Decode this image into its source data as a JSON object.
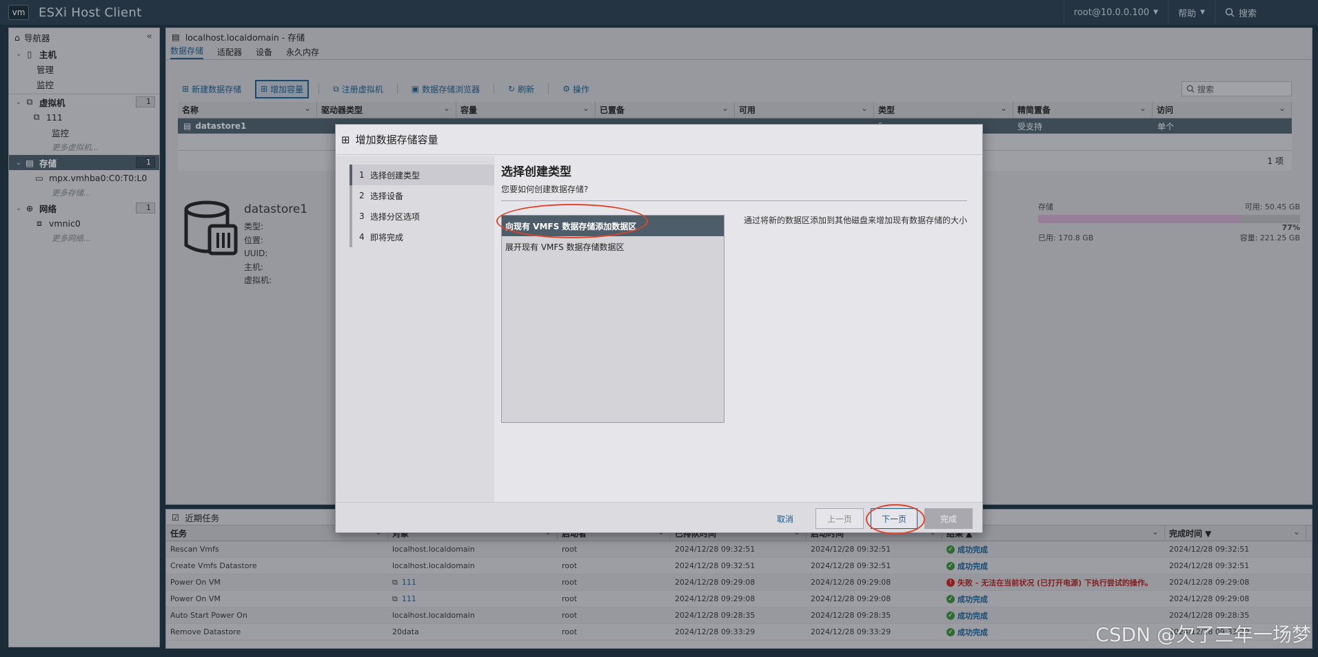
{
  "header": {
    "logo": "vm",
    "title": "ESXi Host Client",
    "user": "root@10.0.0.100",
    "help": "帮助",
    "search": "搜索"
  },
  "navigator": {
    "title": "导航器",
    "host": {
      "label": "主机",
      "children": [
        "管理",
        "监控"
      ]
    },
    "vms": {
      "label": "虚拟机",
      "count": "1",
      "vm": "111",
      "vm_child": "监控",
      "more": "更多虚拟机..."
    },
    "storage": {
      "label": "存储",
      "count": "1",
      "device": "mpx.vmhba0:C0:T0:L0",
      "more": "更多存储..."
    },
    "network": {
      "label": "网络",
      "count": "1",
      "nic": "vmnic0",
      "more": "更多网络..."
    }
  },
  "main": {
    "breadcrumb": "localhost.localdomain - 存储",
    "tabs": [
      "数据存储",
      "适配器",
      "设备",
      "永久内存"
    ],
    "toolbar": {
      "new_ds": "新建数据存储",
      "increase": "增加容量",
      "register_vm": "注册虚拟机",
      "browser": "数据存储浏览器",
      "refresh": "刷新",
      "actions": "操作",
      "search_placeholder": "搜索"
    },
    "columns": [
      "名称",
      "驱动器类型",
      "容量",
      "已置备",
      "可用",
      "类型",
      "精简置备",
      "访问"
    ],
    "row": {
      "name": "datastore1",
      "type_tail": "6",
      "thin": "受支持",
      "access": "单个"
    },
    "count": "1 项",
    "detail": {
      "name": "datastore1",
      "fields": [
        "类型:",
        "位置:",
        "UUID:",
        "主机:",
        "虚拟机:"
      ],
      "storage_label": "存储",
      "free": "可用: 50.45 GB",
      "percent": "77%",
      "used": "已用: 170.8 GB",
      "capacity": "容量: 221.25 GB",
      "used_fraction": 0.77
    }
  },
  "tasks": {
    "title": "近期任务",
    "columns": [
      "任务",
      "对象",
      "启动者",
      "已排队时间",
      "启动时间",
      "结果 ▲",
      "完成时间 ▼"
    ],
    "rows": [
      {
        "task": "Rescan Vmfs",
        "target": "localhost.localdomain",
        "initiator": "root",
        "queued": "2024/12/28 09:32:51",
        "started": "2024/12/28 09:32:51",
        "result": "成功完成",
        "status": "ok",
        "completed": "2024/12/28 09:32:51"
      },
      {
        "task": "Create Vmfs Datastore",
        "target": "localhost.localdomain",
        "initiator": "root",
        "queued": "2024/12/28 09:32:51",
        "started": "2024/12/28 09:32:51",
        "result": "成功完成",
        "status": "ok",
        "completed": "2024/12/28 09:32:51"
      },
      {
        "task": "Power On VM",
        "target": "111",
        "initiator": "root",
        "queued": "2024/12/28 09:29:08",
        "started": "2024/12/28 09:29:08",
        "result": "失败 - 无法在当前状况 (已打开电源) 下执行尝试的操作。",
        "status": "err",
        "completed": "2024/12/28 09:29:08"
      },
      {
        "task": "Power On VM",
        "target": "111",
        "initiator": "root",
        "queued": "2024/12/28 09:29:08",
        "started": "2024/12/28 09:29:08",
        "result": "成功完成",
        "status": "ok",
        "completed": "2024/12/28 09:29:08"
      },
      {
        "task": "Auto Start Power On",
        "target": "localhost.localdomain",
        "initiator": "root",
        "queued": "2024/12/28 09:28:35",
        "started": "2024/12/28 09:28:35",
        "result": "成功完成",
        "status": "ok",
        "completed": "2024/12/28 09:28:35"
      },
      {
        "task": "Remove Datastore",
        "target": "20data",
        "initiator": "root",
        "queued": "2024/12/28 09:33:29",
        "started": "2024/12/28 09:33:29",
        "result": "成功完成",
        "status": "ok",
        "completed": "2024/12/28 09:33:29"
      }
    ]
  },
  "dialog": {
    "title": "增加数据存储容量",
    "steps": [
      "选择创建类型",
      "选择设备",
      "选择分区选项",
      "即将完成"
    ],
    "heading": "选择创建类型",
    "question": "您要如何创建数据存储?",
    "options": [
      "向现有 VMFS 数据存储添加数据区",
      "展开现有 VMFS 数据存储数据区"
    ],
    "description": "通过将新的数据区添加到其他磁盘来增加现有数据存储的大小",
    "buttons": {
      "cancel": "取消",
      "prev": "上一页",
      "next": "下一页",
      "finish": "完成"
    }
  },
  "watermark": "CSDN @欠了三年一场梦"
}
